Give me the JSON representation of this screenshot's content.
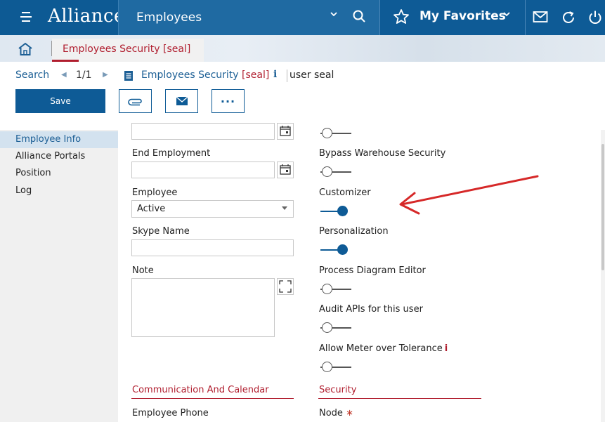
{
  "header": {
    "logo": "Alliance",
    "module_title": "Employees",
    "favorites_label": "My Favorites"
  },
  "tabs": {
    "active_tab": "Employees Security [seal]"
  },
  "nav": {
    "search_label": "Search",
    "page_indicator": "1/1",
    "record_title": "Employees Security",
    "record_suffix": "[seal]",
    "info_glyph": "i",
    "record_user": "user seal"
  },
  "toolbar": {
    "save_label": "Save",
    "more_glyph": "···"
  },
  "sidebar": {
    "items": [
      {
        "label": "Employee Info",
        "active": true
      },
      {
        "label": "Alliance Portals",
        "active": false
      },
      {
        "label": "Position",
        "active": false
      },
      {
        "label": "Log",
        "active": false
      }
    ]
  },
  "form_left": {
    "end_employment_label": "End Employment",
    "employee_label": "Employee",
    "employee_value": "Active",
    "skype_label": "Skype Name",
    "note_label": "Note"
  },
  "form_right": {
    "toggles": [
      {
        "label": "",
        "on": false
      },
      {
        "label": "Bypass Warehouse Security",
        "on": false
      },
      {
        "label": "Customizer",
        "on": true
      },
      {
        "label": "Personalization",
        "on": true
      },
      {
        "label": "Process Diagram Editor",
        "on": false
      },
      {
        "label": "Audit APIs for this user",
        "on": false
      },
      {
        "label": "Allow Meter over Tolerance",
        "on": false
      }
    ],
    "tolerance_info_glyph": "i"
  },
  "sections": {
    "communication": "Communication And Calendar",
    "security": "Security",
    "employee_phone_label": "Employee Phone",
    "node_label": "Node",
    "required_glyph": "∗"
  },
  "colors": {
    "brand": "#0e5b96",
    "accent_red": "#b01d2e",
    "annotation_arrow": "#d62828"
  },
  "icons": [
    "menu-icon",
    "search-icon",
    "star-icon",
    "chevron-down-icon",
    "mail-icon",
    "refresh-icon",
    "power-icon",
    "home-icon",
    "document-icon",
    "paperclip-icon",
    "calendar-icon",
    "expand-icon"
  ]
}
